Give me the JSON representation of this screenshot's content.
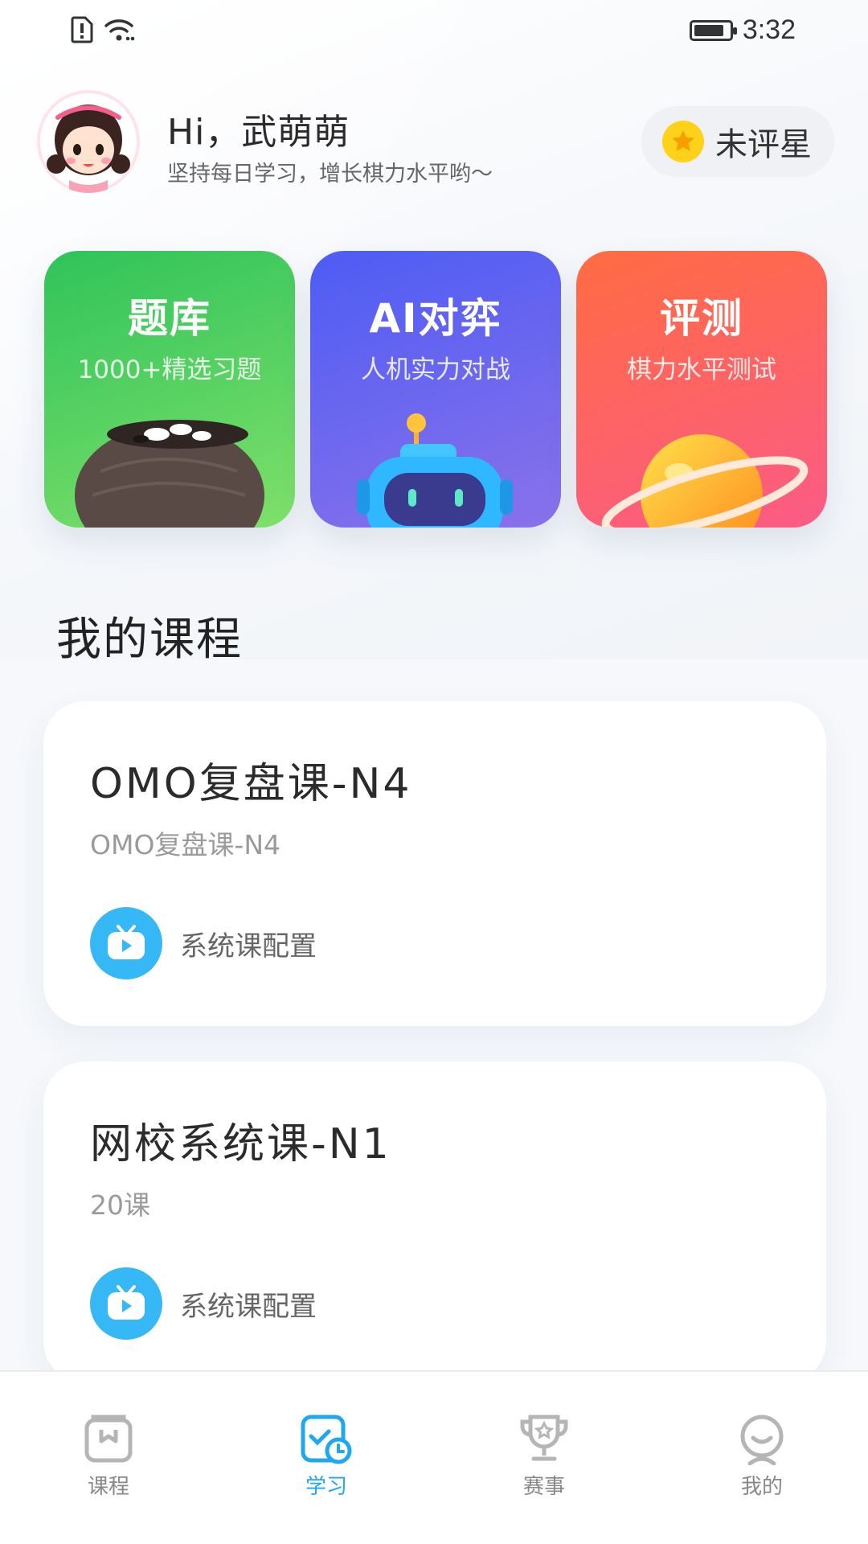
{
  "status_bar": {
    "time": "3:32",
    "battery_level": 0.85,
    "icons": [
      "alert-icon",
      "wifi-icon",
      "battery-icon"
    ]
  },
  "header": {
    "greeting": "Hi，武萌萌",
    "subtitle": "坚持每日学习，增长棋力水平哟～",
    "star_badge": "未评星",
    "avatar_icon": "girl-avatar-icon",
    "star_icon": "star-icon"
  },
  "features": [
    {
      "title": "题库",
      "subtitle": "1000+精选习题",
      "icon": "go-bowl-icon",
      "color_start": "#2fc35a",
      "color_end": "#7fe06a"
    },
    {
      "title": "AI对弈",
      "subtitle": "人机实力对战",
      "icon": "robot-icon",
      "color_start": "#4d5cf4",
      "color_end": "#8a72ea"
    },
    {
      "title": "评测",
      "subtitle": "棋力水平测试",
      "icon": "planet-icon",
      "color_start": "#ff6c42",
      "color_end": "#fb5b86"
    }
  ],
  "section": {
    "title": "我的课程"
  },
  "courses": [
    {
      "title": "OMO复盘课-N4",
      "subtitle": "OMO复盘课-N4",
      "tag": "系统课配置",
      "tag_icon": "tv-play-icon"
    },
    {
      "title": "网校系统课-N1",
      "subtitle": "20课",
      "tag": "系统课配置",
      "tag_icon": "tv-play-icon"
    }
  ],
  "nav": [
    {
      "label": "课程",
      "icon": "course-box-icon",
      "active": false
    },
    {
      "label": "学习",
      "icon": "study-clock-icon",
      "active": true
    },
    {
      "label": "赛事",
      "icon": "trophy-icon",
      "active": false
    },
    {
      "label": "我的",
      "icon": "person-icon",
      "active": false
    }
  ],
  "colors": {
    "accent": "#1fa8f0",
    "tag_circle": "#36b7f6",
    "star": "#ffd21a"
  }
}
